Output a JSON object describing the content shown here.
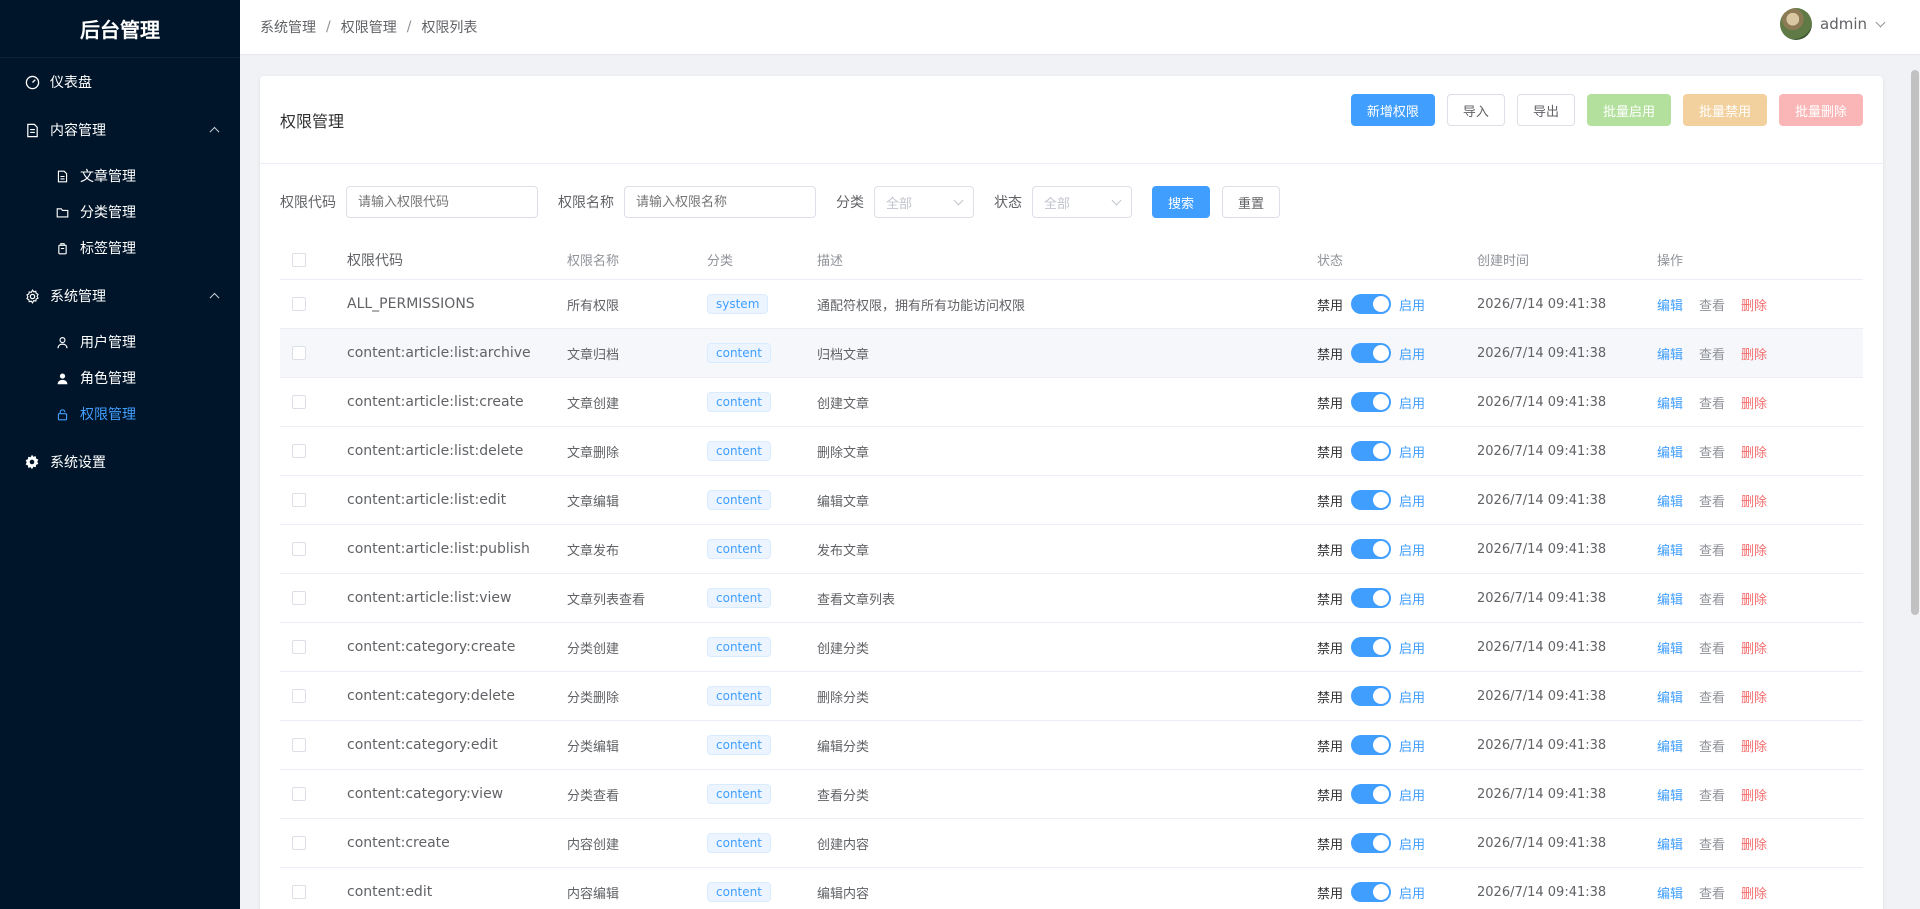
{
  "app": {
    "title": "后台管理"
  },
  "sidebar": {
    "items": [
      {
        "label": "仪表盘",
        "icon": "dashboard-icon"
      },
      {
        "label": "内容管理",
        "icon": "document-icon",
        "children": [
          {
            "label": "文章管理",
            "icon": "file-icon"
          },
          {
            "label": "分类管理",
            "icon": "folder-icon"
          },
          {
            "label": "标签管理",
            "icon": "tag-icon"
          }
        ]
      },
      {
        "label": "系统管理",
        "icon": "gear-icon",
        "children": [
          {
            "label": "用户管理",
            "icon": "user-icon"
          },
          {
            "label": "角色管理",
            "icon": "user-filled-icon"
          },
          {
            "label": "权限管理",
            "icon": "lock-icon",
            "active": true
          }
        ]
      },
      {
        "label": "系统设置",
        "icon": "settings-icon"
      }
    ]
  },
  "header": {
    "breadcrumb": [
      "系统管理",
      "权限管理",
      "权限列表"
    ],
    "user": "admin"
  },
  "card": {
    "title": "权限管理",
    "toolbar": {
      "add": "新增权限",
      "import": "导入",
      "export": "导出",
      "batch_enable": "批量启用",
      "batch_disable": "批量禁用",
      "batch_delete": "批量删除"
    }
  },
  "filters": {
    "code_label": "权限代码",
    "code_placeholder": "请输入权限代码",
    "name_label": "权限名称",
    "name_placeholder": "请输入权限名称",
    "category_label": "分类",
    "category_value": "全部",
    "status_label": "状态",
    "status_value": "全部",
    "search": "搜索",
    "reset": "重置"
  },
  "table": {
    "headers": {
      "code": "权限代码",
      "name": "权限名称",
      "category": "分类",
      "desc": "描述",
      "status": "状态",
      "time": "创建时间",
      "ops": "操作"
    },
    "status_off": "禁用",
    "status_on": "启用",
    "op_edit": "编辑",
    "op_view": "查看",
    "op_delete": "删除",
    "rows": [
      {
        "code": "ALL_PERMISSIONS",
        "name": "所有权限",
        "category": "system",
        "desc": "通配符权限，拥有所有功能访问权限",
        "time": "2026/7/14 09:41:38"
      },
      {
        "code": "content:article:list:archive",
        "name": "文章归档",
        "category": "content",
        "desc": "归档文章",
        "time": "2026/7/14 09:41:38"
      },
      {
        "code": "content:article:list:create",
        "name": "文章创建",
        "category": "content",
        "desc": "创建文章",
        "time": "2026/7/14 09:41:38"
      },
      {
        "code": "content:article:list:delete",
        "name": "文章删除",
        "category": "content",
        "desc": "删除文章",
        "time": "2026/7/14 09:41:38"
      },
      {
        "code": "content:article:list:edit",
        "name": "文章编辑",
        "category": "content",
        "desc": "编辑文章",
        "time": "2026/7/14 09:41:38"
      },
      {
        "code": "content:article:list:publish",
        "name": "文章发布",
        "category": "content",
        "desc": "发布文章",
        "time": "2026/7/14 09:41:38"
      },
      {
        "code": "content:article:list:view",
        "name": "文章列表查看",
        "category": "content",
        "desc": "查看文章列表",
        "time": "2026/7/14 09:41:38"
      },
      {
        "code": "content:category:create",
        "name": "分类创建",
        "category": "content",
        "desc": "创建分类",
        "time": "2026/7/14 09:41:38"
      },
      {
        "code": "content:category:delete",
        "name": "分类删除",
        "category": "content",
        "desc": "删除分类",
        "time": "2026/7/14 09:41:38"
      },
      {
        "code": "content:category:edit",
        "name": "分类编辑",
        "category": "content",
        "desc": "编辑分类",
        "time": "2026/7/14 09:41:38"
      },
      {
        "code": "content:category:view",
        "name": "分类查看",
        "category": "content",
        "desc": "查看分类",
        "time": "2026/7/14 09:41:38"
      },
      {
        "code": "content:create",
        "name": "内容创建",
        "category": "content",
        "desc": "创建内容",
        "time": "2026/7/14 09:41:38"
      },
      {
        "code": "content:edit",
        "name": "内容编辑",
        "category": "content",
        "desc": "编辑内容",
        "time": "2026/7/14 09:41:38"
      }
    ]
  },
  "colors": {
    "sidebar_bg": "#001529",
    "primary": "#409eff",
    "danger": "#f56c6c"
  }
}
